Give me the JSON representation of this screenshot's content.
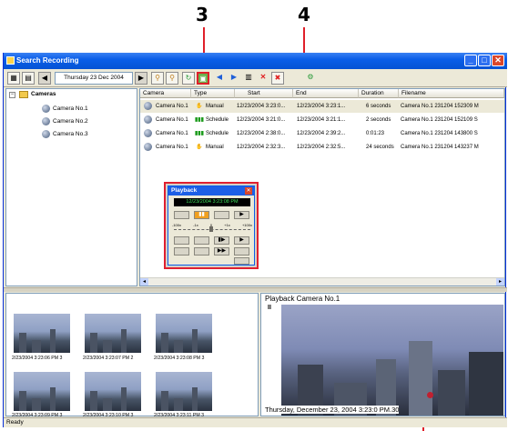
{
  "callouts": {
    "three": "3",
    "four": "4"
  },
  "window": {
    "title": "Search Recording",
    "minimize": "_",
    "restore": "□",
    "close": "✕"
  },
  "toolbar": {
    "date": "Thursday 23 Dec 2004"
  },
  "tree": {
    "root": "Cameras",
    "items": [
      "Camera No.1",
      "Camera No.2",
      "Camera No.3"
    ]
  },
  "table": {
    "headers": [
      "Camera",
      "Type",
      "Start",
      "End",
      "Duration",
      "Filename"
    ],
    "rows": [
      {
        "camera": "Camera No.1",
        "type": "Manual",
        "start": "12/23/2004 3:23:0...",
        "end": "12/23/2004 3:23:1...",
        "duration": "6 seconds",
        "filename": "Camera No.1 231204 152309 M"
      },
      {
        "camera": "Camera No.1",
        "type": "Schedule",
        "start": "12/23/2004 3:21:0...",
        "end": "12/23/2004 3:21:1...",
        "duration": "2 seconds",
        "filename": "Camera No.1 231204 152109 S"
      },
      {
        "camera": "Camera No.1",
        "type": "Schedule",
        "start": "12/23/2004 2:38:0...",
        "end": "12/23/2004 2:39:2...",
        "duration": "0:01:23",
        "filename": "Camera No.1 231204 143800 S"
      },
      {
        "camera": "Camera No.1",
        "type": "Manual",
        "start": "12/23/2004 2:32:3...",
        "end": "12/23/2004 2:32:5...",
        "duration": "24 seconds",
        "filename": "Camera No.1 231204 143237 M"
      }
    ]
  },
  "playback_dialog": {
    "title": "Playback",
    "close": "✕",
    "time": "12/23/2004 3:23:08 PM",
    "speed_labels": [
      "-100x",
      "-1x",
      "0",
      "+1x",
      "+100x"
    ],
    "rows": [
      [
        "",
        "▮▮",
        "",
        "▶"
      ],
      [
        "",
        "",
        "▮▶",
        "▶"
      ],
      [
        "",
        "",
        "▶▶",
        ""
      ]
    ]
  },
  "thumbnails": [
    "2/23/2004 3:23:06 PM 3",
    "2/23/2004 3:23:07 PM 2",
    "2/23/2004 3:23:08 PM 3",
    "2/23/2004 3:23:09 PM 3",
    "2/23/2004 3:23:10 PM 3",
    "2/23/2004 3:23:11 PM 3"
  ],
  "playback_view": {
    "title": "Playback Camera No.1",
    "pause": "II",
    "timestamp": "Thursday, December 23, 2004 3:23:0",
    "timestamp_suffix": "PM.30"
  },
  "status": {
    "text": "Ready"
  },
  "colors": {
    "callout_red": "#e0202a",
    "titlebar": "#0a5ee8"
  }
}
